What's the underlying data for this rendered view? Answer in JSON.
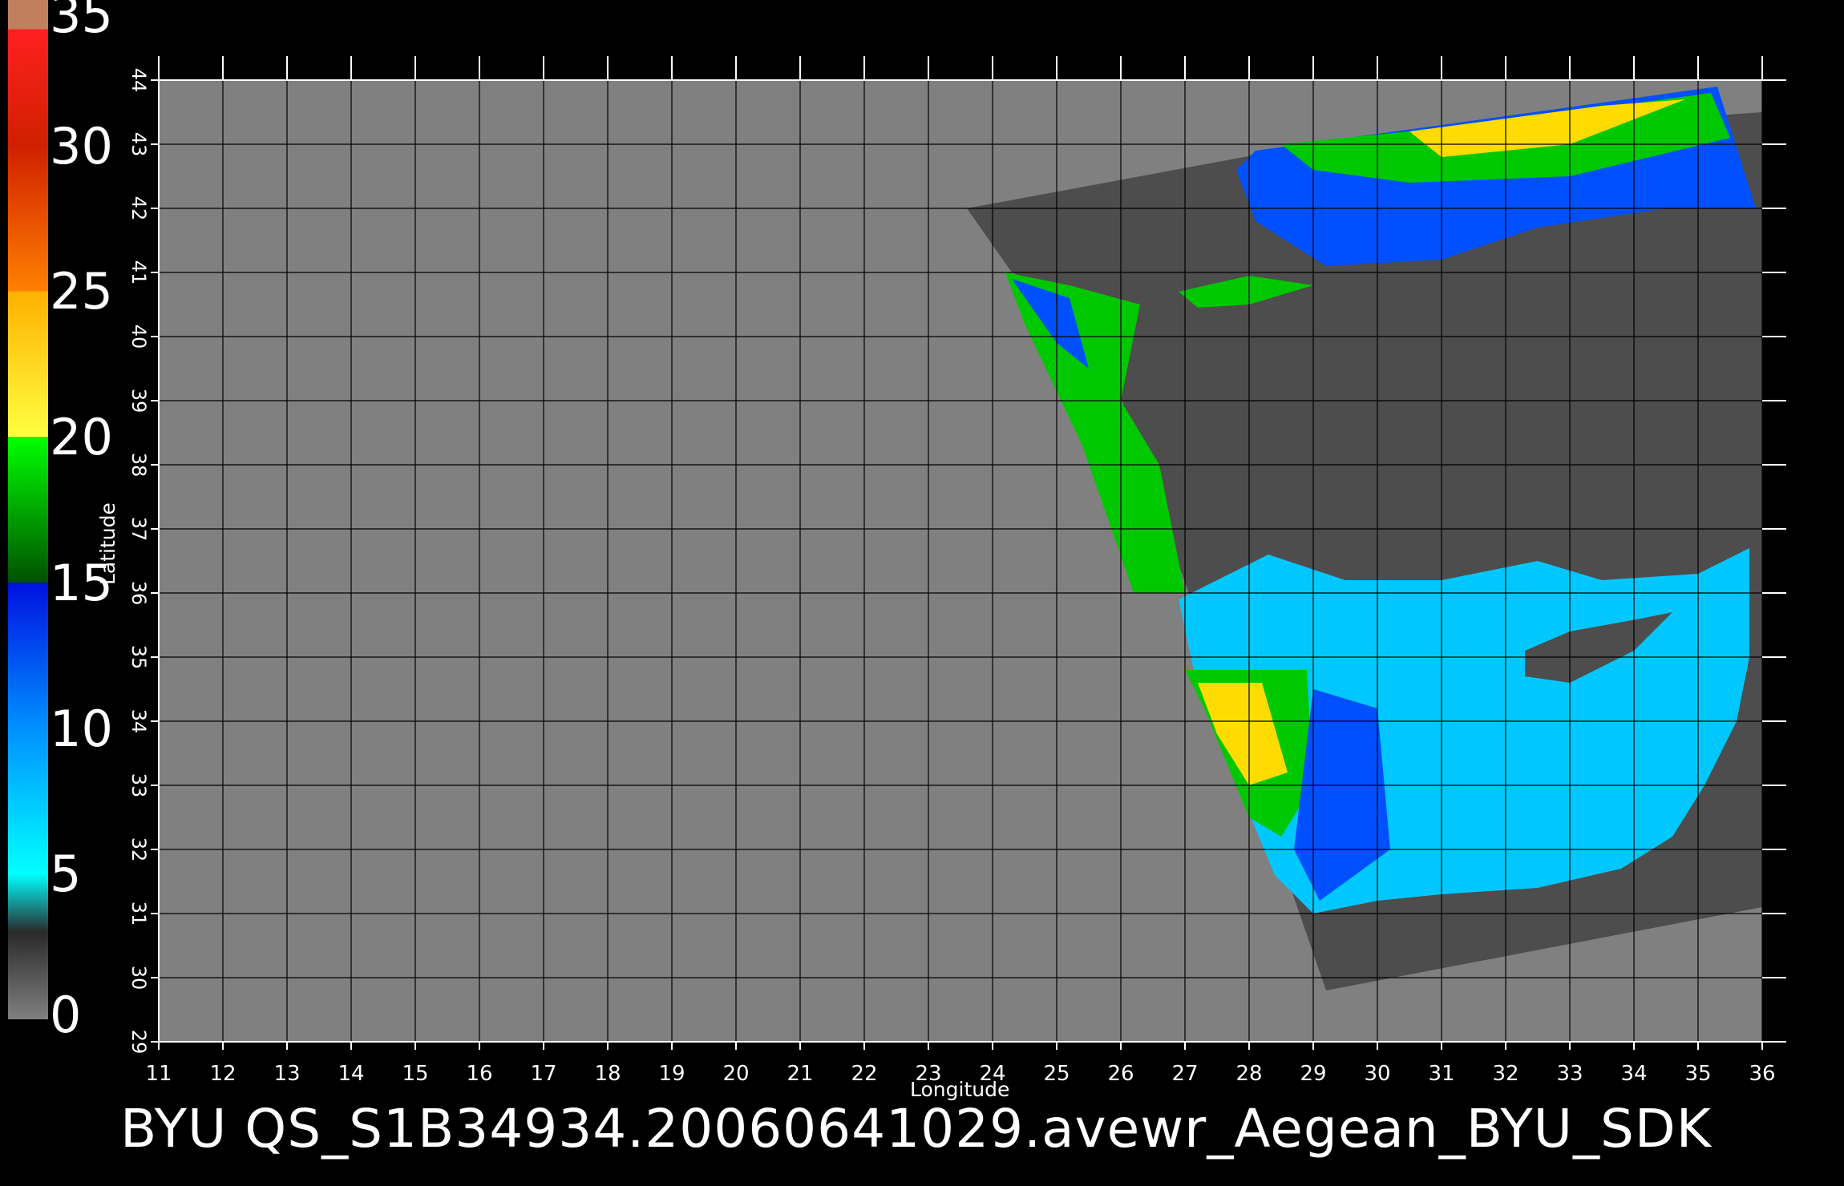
{
  "title": "BYU  QS_S1B34934.20060641029.avewr_Aegean_BYU_SDK",
  "axes": {
    "xlabel": "Longitude",
    "ylabel": "Latitude",
    "lon_ticks": [
      11,
      12,
      13,
      14,
      15,
      16,
      17,
      18,
      19,
      20,
      21,
      22,
      23,
      24,
      25,
      26,
      27,
      28,
      29,
      30,
      31,
      32,
      33,
      34,
      35,
      36
    ],
    "lat_ticks": [
      29,
      30,
      31,
      32,
      33,
      34,
      35,
      36,
      37,
      38,
      39,
      40,
      41,
      42,
      43,
      44
    ],
    "lon_range": [
      11,
      36
    ],
    "lat_range": [
      29,
      44
    ]
  },
  "colorbar": {
    "labels": [
      "35",
      "30",
      "25",
      "20",
      "15",
      "10",
      "5",
      "0"
    ],
    "range": [
      0,
      35
    ],
    "stops": [
      {
        "v": 0,
        "c": "#808080"
      },
      {
        "v": 3,
        "c": "#2a2a2a"
      },
      {
        "v": 5,
        "c": "#00ffff"
      },
      {
        "v": 10,
        "c": "#0090ff"
      },
      {
        "v": 15,
        "c": "#0010e0"
      },
      {
        "v": 15,
        "c": "#005000"
      },
      {
        "v": 20,
        "c": "#00ff00"
      },
      {
        "v": 20,
        "c": "#ffff40"
      },
      {
        "v": 25,
        "c": "#ffb000"
      },
      {
        "v": 25,
        "c": "#ff8000"
      },
      {
        "v": 30,
        "c": "#d02000"
      },
      {
        "v": 34,
        "c": "#ff2020"
      },
      {
        "v": 34,
        "c": "#c08060"
      },
      {
        "v": 35,
        "c": "#c08060"
      }
    ]
  },
  "colors": {
    "background": "#000000",
    "land": "#808080",
    "swath_land": "#4d4d4d",
    "grid": "#000000",
    "wind_low": "#00c8ff",
    "wind_mid": "#0050ff",
    "wind_high": "#00c800",
    "wind_strong": "#ffdc00"
  }
}
